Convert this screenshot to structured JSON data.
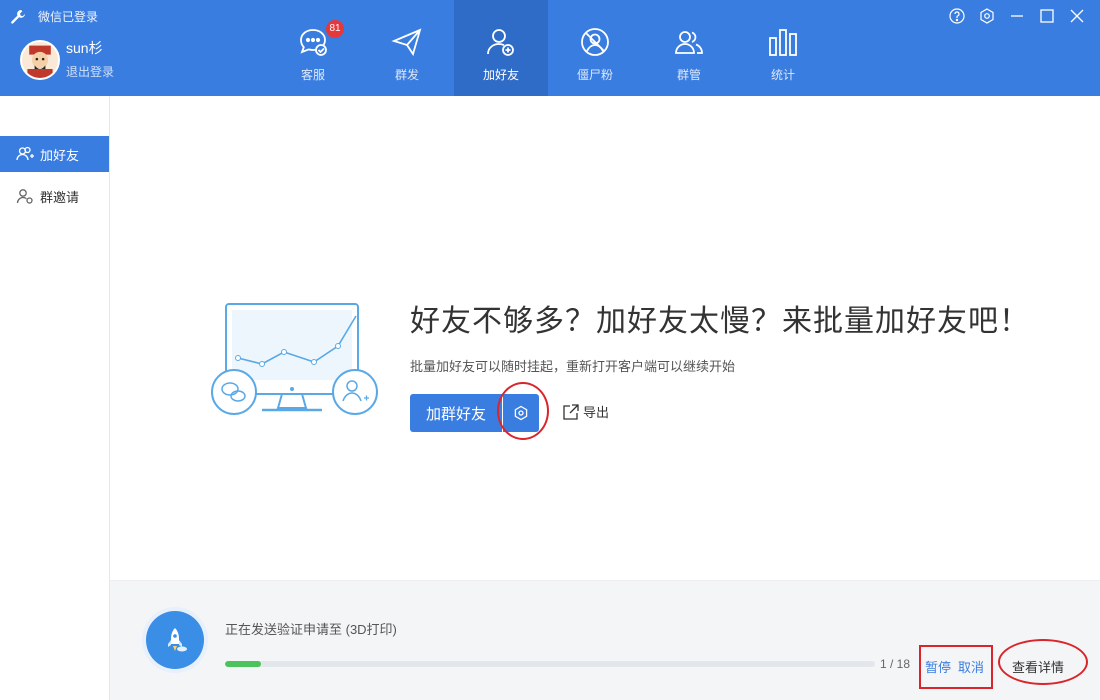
{
  "window": {
    "status": "微信已登录",
    "controls": [
      "help-icon",
      "settings-icon",
      "minimize-icon",
      "maximize-icon",
      "close-icon"
    ]
  },
  "user": {
    "name": "sun杉",
    "logout_label": "退出登录"
  },
  "nav": {
    "tabs": [
      {
        "label": "客服",
        "icon": "chat-icon",
        "badge": "81"
      },
      {
        "label": "群发",
        "icon": "send-icon"
      },
      {
        "label": "加好友",
        "icon": "add-friend-icon",
        "active": true
      },
      {
        "label": "僵尸粉",
        "icon": "zombie-icon"
      },
      {
        "label": "群管",
        "icon": "group-icon"
      },
      {
        "label": "统计",
        "icon": "stats-icon"
      }
    ]
  },
  "sidebar": {
    "items": [
      {
        "label": "加好友",
        "icon": "add-friend-icon",
        "active": true
      },
      {
        "label": "群邀请",
        "icon": "invite-icon"
      }
    ]
  },
  "main": {
    "headline": "好友不够多？加好友太慢？来批量加好友吧！",
    "subline": "批量加好友可以随时挂起，重新打开客户端可以继续开始",
    "add_button": "加群好友",
    "export_label": "导出"
  },
  "progress": {
    "text": "正在发送验证申请至 (3D打印)",
    "count": "1 / 18",
    "fraction": 0.0556,
    "pause_label": "暂停",
    "cancel_label": "取消",
    "details_label": "查看详情"
  },
  "colors": {
    "accent": "#3a7de0",
    "active_tab": "#2f6cc8",
    "badge": "#e5383b",
    "progress": "#4cc25a",
    "annotation": "#d8262c"
  }
}
